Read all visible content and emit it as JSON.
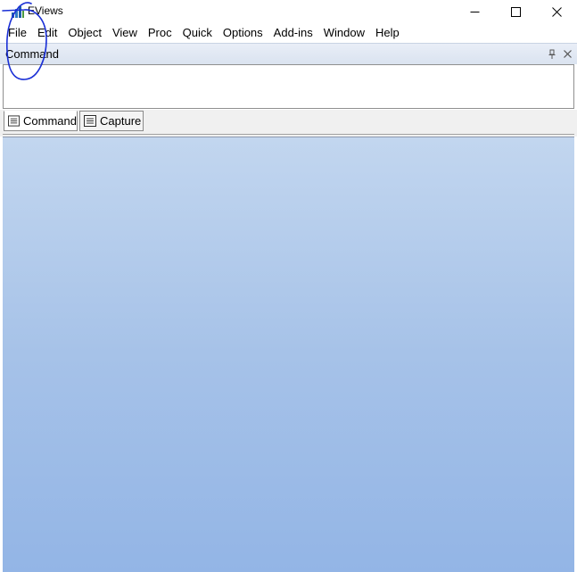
{
  "window": {
    "title": "EViews",
    "controls": {
      "minimize": "minimize",
      "maximize": "maximize",
      "close": "close"
    }
  },
  "menubar": {
    "items": [
      {
        "label": "File"
      },
      {
        "label": "Edit"
      },
      {
        "label": "Object"
      },
      {
        "label": "View"
      },
      {
        "label": "Proc"
      },
      {
        "label": "Quick"
      },
      {
        "label": "Options"
      },
      {
        "label": "Add-ins"
      },
      {
        "label": "Window"
      },
      {
        "label": "Help"
      }
    ]
  },
  "command_panel": {
    "title": "Command",
    "input_value": "",
    "tabs": [
      {
        "label": "Command",
        "active": true
      },
      {
        "label": "Capture",
        "active": false
      }
    ]
  },
  "icons": {
    "app": "eviews-app-icon",
    "pin": "pin-icon",
    "panel_close": "close-icon",
    "tab": "document-icon"
  },
  "colors": {
    "workspace_top": "#c2d6ef",
    "workspace_bottom": "#93b5e6",
    "annotation": "#1a2fd6"
  }
}
